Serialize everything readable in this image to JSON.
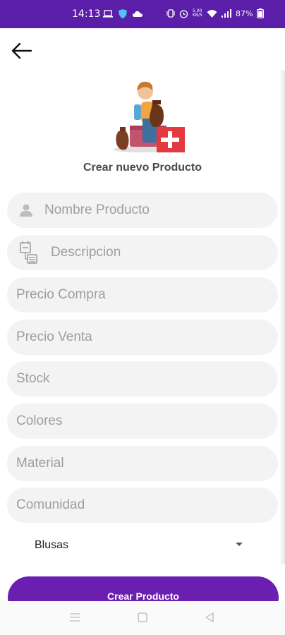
{
  "status_bar": {
    "time": "14:13",
    "battery": "87%",
    "data_speed": "5.00 KB/S"
  },
  "header": {
    "back_icon": "arrow-left-icon",
    "title": "Crear nuevo Producto"
  },
  "form": {
    "nombre": {
      "placeholder": "Nombre Producto",
      "icon": "person-icon"
    },
    "descripcion": {
      "placeholder": "Descripcion",
      "icon": "description-icon"
    },
    "precio_compra": {
      "placeholder": "Precio Compra"
    },
    "precio_venta": {
      "placeholder": "Precio Venta"
    },
    "stock": {
      "placeholder": "Stock"
    },
    "colores": {
      "placeholder": "Colores"
    },
    "material": {
      "placeholder": "Material"
    },
    "comunidad": {
      "placeholder": "Comunidad"
    },
    "categoria": {
      "selected": "Blusas"
    },
    "submit_label": "Crear Producto"
  },
  "colors": {
    "accent": "#6a1fb0",
    "status_bar": "#5b1ea8",
    "field_bg": "#f3f3f3",
    "placeholder": "#9e9e9e"
  }
}
